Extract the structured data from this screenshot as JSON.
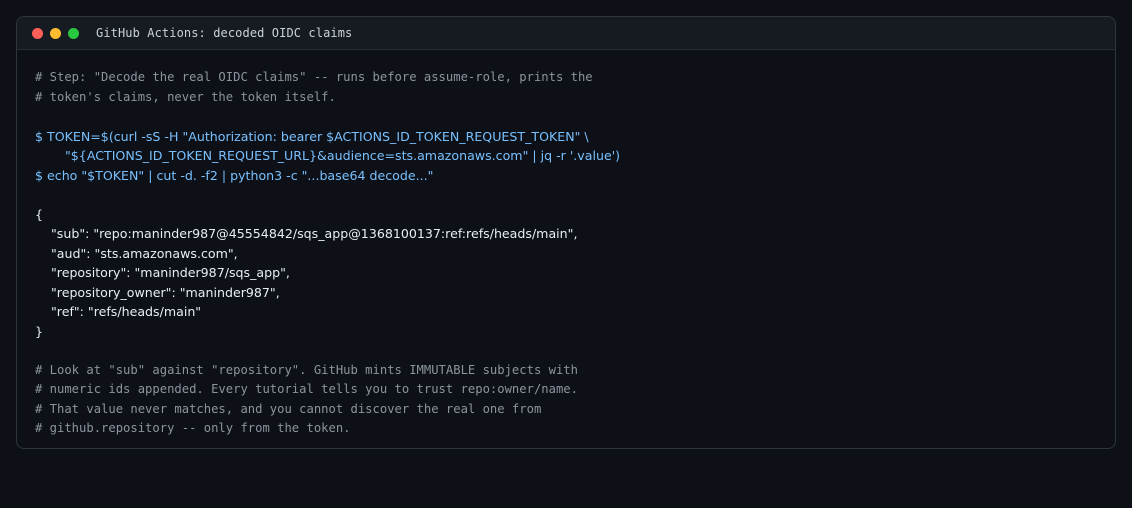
{
  "window": {
    "title": "GitHub Actions: decoded OIDC claims"
  },
  "colors": {
    "background": "#0d1017",
    "comment": "#8b949e",
    "command": "#79c0ff",
    "json": "#e6edf3",
    "dot_red": "#ff5f57",
    "dot_yellow": "#febc2e",
    "dot_green": "#28c840"
  },
  "comment_top": [
    "# Step: \"Decode the real OIDC claims\" -- runs before assume-role, prints the",
    "# token's claims, never the token itself."
  ],
  "commands": [
    "$ TOKEN=$(curl -sS -H \"Authorization: bearer $ACTIONS_ID_TOKEN_REQUEST_TOKEN\" \\",
    "\"${ACTIONS_ID_TOKEN_REQUEST_URL}&audience=sts.amazonaws.com\" | jq -r '.value')",
    "$ echo \"$TOKEN\" | cut -d. -f2 | python3 -c \"...base64 decode...\""
  ],
  "json_output": {
    "open": "{",
    "lines": [
      "\"sub\": \"repo:maninder987@45554842/sqs_app@1368100137:ref:refs/heads/main\",",
      "\"aud\": \"sts.amazonaws.com\",",
      "\"repository\": \"maninder987/sqs_app\",",
      "\"repository_owner\": \"maninder987\",",
      "\"ref\": \"refs/heads/main\""
    ],
    "close": "}"
  },
  "comment_bottom": [
    "# Look at \"sub\" against \"repository\". GitHub mints IMMUTABLE subjects with",
    "# numeric ids appended. Every tutorial tells you to trust repo:owner/name.",
    "# That value never matches, and you cannot discover the real one from",
    "# github.repository -- only from the token."
  ]
}
